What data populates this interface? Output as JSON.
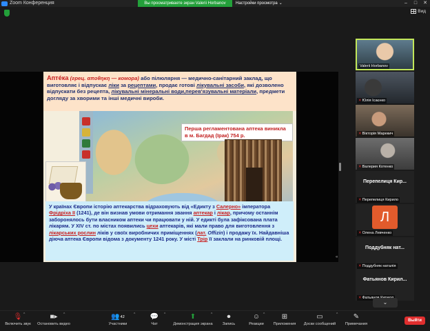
{
  "window": {
    "app_title": "Zoom Конференция",
    "share_banner": "Вы просматриваете экран Valerii Horbanov",
    "view_settings": "Настройки просмотра",
    "view_button": "Вид",
    "controls": [
      "–",
      "□",
      "✕"
    ]
  },
  "slide": {
    "top_term": "Аптéка",
    "top_paren": "(грец. αποθηκη — комора)",
    "top_text_1": "або пілюлярня — медично-санітарний заклад, що виготовляє і відпускає",
    "top_link_1": "ліки",
    "top_text_2": "за",
    "top_link_2": "рецептами",
    "top_text_3": ", продає готові",
    "top_link_3": "лікувальні засоби",
    "top_text_4": ", які дозволено відпускати без рецепта,",
    "top_link_4": "лікувальні мінеральні води,перев'язувальні матеріали",
    "top_text_5": ", предмети догляду за хворими та інші медичні вироби.",
    "map_note": "Перша регламентована аптека виникла в м. Багдад (Ірак) 754 р.",
    "bottom": {
      "t1": "У країнах Європи історію аптекарства відраховують від «Едикту з",
      "l1": "Салерно»",
      "t2": "імператора",
      "l2": "Фрідріха II",
      "t3": "(1241), де він визнав умови отримання звання",
      "l3": "аптекар",
      "t4": "і",
      "l4": "лікар",
      "t5": ", причому останнім заборонялось бути власником аптеки чи працювати у ній. У едикті була зафіксована плата лікарям. У XIV ст. по містах появились",
      "l5": "цехи",
      "t6": "аптекарів, які мали право для виготовлення з",
      "l6": "лікарських рослин",
      "t7": "ліків у своїх виробничих приміщеннях (",
      "l7": "лат.",
      "t8": "Offizin",
      "t9": ") і продажу їх. Найдавніша діюча аптека Європи відома з документу 1241 року.",
      "t10": "У місті",
      "l10": "Трір",
      "t11": "її заклали на ринковій площі."
    }
  },
  "participants": [
    {
      "name": "Valerii Horbanov",
      "muted": false,
      "video": true
    },
    {
      "name": "Юлія Ісаєнко",
      "muted": true,
      "video": true
    },
    {
      "name": "Вікторія Марекич",
      "muted": true,
      "video": true
    },
    {
      "name": "Валерия Котенко",
      "muted": true,
      "video": true
    },
    {
      "big": "Перепелиця Кир...",
      "name": "Перепелиця Кирило",
      "muted": true,
      "video": false
    },
    {
      "avatar": "Л",
      "name": "Олена Левченко",
      "muted": true,
      "video": false
    },
    {
      "big": "Поддубняк нат...",
      "name": "Поддубняк наталія",
      "muted": true,
      "video": false
    },
    {
      "big": "Фатьянов Кирил...",
      "name": "Фатьянов Кирилл",
      "muted": true,
      "video": false
    }
  ],
  "toolbar": {
    "unmute": "Включить звук",
    "video": "Остановить видео",
    "participants": "Участники",
    "participants_count": "42",
    "chat": "Чат",
    "share": "Демонстрация экрана",
    "record": "Запись",
    "reactions": "Реакции",
    "apps": "Приложения",
    "whiteboard": "Доски сообщений",
    "notes": "Примечания",
    "leave": "Выйти"
  },
  "colors": {
    "share_banner": "#23a03a",
    "leave_button": "#e02e2e",
    "active_speaker_border": "#c3e85a"
  },
  "icons": [
    "zoom-logo-icon",
    "shield-icon",
    "grid-view-icon",
    "mic-muted-icon",
    "video-icon",
    "participants-icon",
    "chat-icon",
    "share-screen-icon",
    "record-icon",
    "reactions-icon",
    "apps-icon",
    "whiteboard-icon",
    "notes-icon",
    "chevron-down-icon"
  ]
}
